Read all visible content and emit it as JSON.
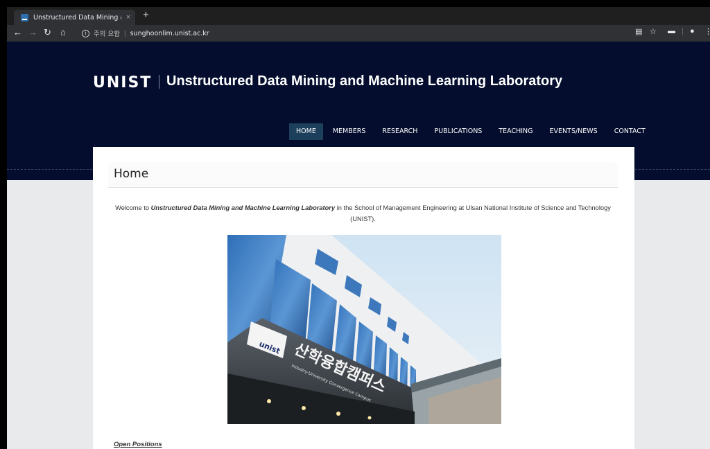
{
  "browser": {
    "tab_title": "Unstructured Data Mining and",
    "tab_close": "×",
    "new_tab": "+",
    "security_warning": "주의 요함",
    "url": "sunghoonlim.unist.ac.kr"
  },
  "site": {
    "logo": "UNIST",
    "title": "Unstructured Data Mining and Machine Learning Laboratory"
  },
  "nav": {
    "items": [
      {
        "label": "HOME"
      },
      {
        "label": "MEMBERS"
      },
      {
        "label": "RESEARCH"
      },
      {
        "label": "PUBLICATIONS"
      },
      {
        "label": "TEACHING"
      },
      {
        "label": "EVENTS/NEWS"
      },
      {
        "label": "CONTACT"
      }
    ]
  },
  "page": {
    "heading": "Home",
    "welcome_prefix": "Welcome to ",
    "welcome_lab": "Unstructured Data Mining and Machine Learning Laboratory",
    "welcome_suffix": " in the School of Management Engineering at Ulsan National Institute of Science and Technology (UNIST).",
    "image_sign_korean": "산학융합캠퍼스",
    "image_sign_english": "Industry-University Convergence Campus",
    "image_sign_logo": "unist",
    "open_positions": "Open Positions"
  },
  "colors": {
    "hero_bg": "#040d2e",
    "nav_active": "#1c3f5c"
  }
}
